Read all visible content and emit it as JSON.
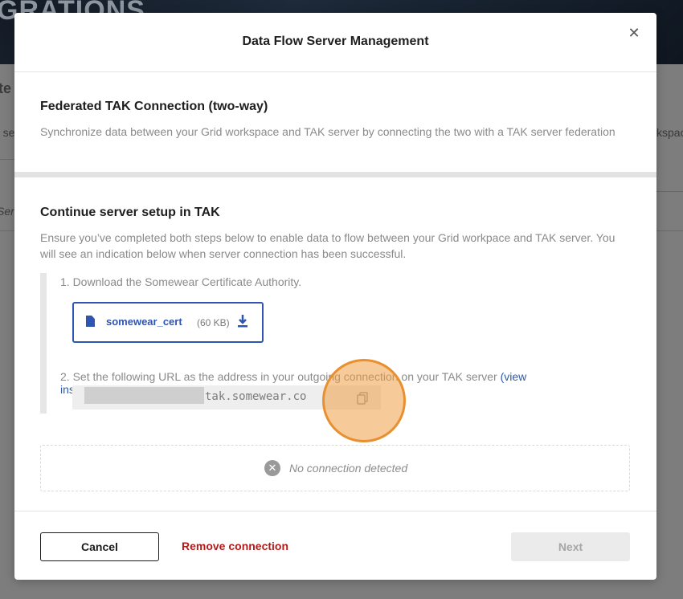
{
  "background": {
    "banner_title": "GRATIONS",
    "fragments": [
      "te",
      "n se",
      "Ser",
      "kspac"
    ]
  },
  "modal": {
    "title": "Data Flow Server Management",
    "close_icon": "close-icon",
    "section1": {
      "title": "Federated TAK Connection (two-way)",
      "subtitle": "Synchronize data between your Grid workspace and TAK server by connecting the two with a TAK server federation"
    },
    "section2": {
      "title": "Continue server setup in TAK",
      "description": "Ensure you’ve completed both steps below to enable data to flow between your Grid workpace and TAK server. You will see an indication below when server connection has been successful."
    },
    "steps": {
      "step1": "1. Download the Somewear Certificate Authority.",
      "cert": {
        "name": "somewear_cert",
        "size": "(60 KB)",
        "file_icon": "file-icon",
        "download_icon": "download-icon"
      },
      "step2_prefix": "2. Set the following URL as the address in your outgoing connection on your TAK server ",
      "step2_link": "(view instructions)",
      "step2_suffix": ".",
      "url_value": "tak.somewear.co",
      "copy_icon": "copy-icon"
    },
    "status": {
      "icon": "x-circle-icon",
      "text": "No connection detected"
    },
    "footer": {
      "cancel_label": "Cancel",
      "remove_label": "Remove connection",
      "next_label": "Next"
    }
  },
  "colors": {
    "accent": "#2e55b0",
    "danger": "#b31b1b",
    "highlight": "#e8902f"
  }
}
